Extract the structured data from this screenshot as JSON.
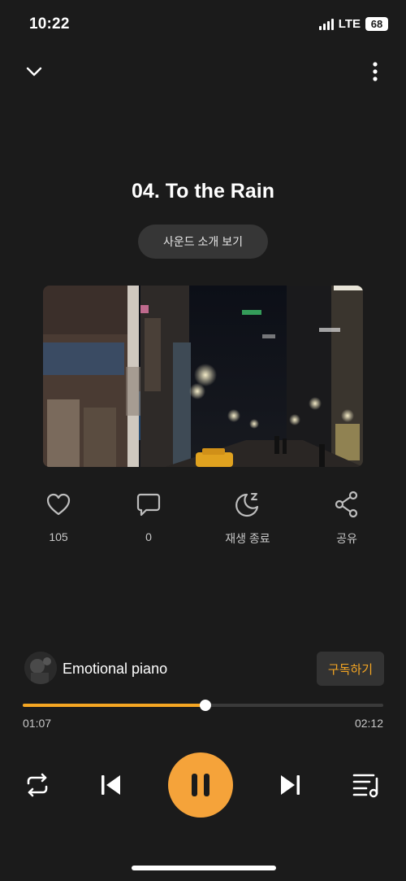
{
  "status_bar": {
    "time": "10:22",
    "network": "LTE",
    "battery": "68"
  },
  "player": {
    "title": "04. To the Rain",
    "intro_label": "사운드 소개 보기"
  },
  "actions": {
    "like_count": "105",
    "comment_count": "0",
    "sleep_timer_label": "재생 종료",
    "share_label": "공유"
  },
  "channel": {
    "name": "Emotional piano",
    "subscribe_label": "구독하기"
  },
  "progress": {
    "current": "01:07",
    "total": "02:12",
    "fraction": 0.507
  },
  "colors": {
    "accent": "#f5a623",
    "background": "#1b1b1b"
  },
  "icons": [
    "chevron-down-icon",
    "more-vertical-icon",
    "heart-icon",
    "comment-icon",
    "moon-sleep-icon",
    "share-icon",
    "repeat-icon",
    "skip-previous-icon",
    "pause-icon",
    "skip-next-icon",
    "playlist-icon"
  ]
}
